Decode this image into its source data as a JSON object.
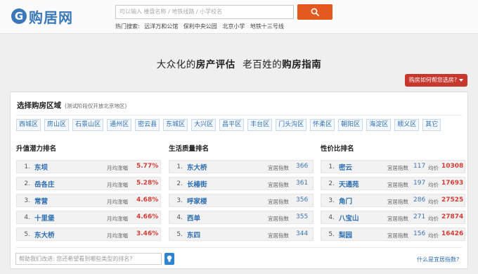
{
  "header": {
    "logo_text": "购居网",
    "logo_letter": "G",
    "search_placeholder": "可以输入 楼盘名称 / 地铁线路 / 小学校名",
    "hot_label": "热门搜索:",
    "hot_links": [
      "远洋万和公馆",
      "保利中央公园",
      "北京小学",
      "地铁十三号线"
    ]
  },
  "slogan": {
    "part1": "大众化的",
    "part2": "房产评估",
    "part3": "老百姓的",
    "part4": "购房指南"
  },
  "help_button": "购房如何帮您选房?",
  "panel": {
    "title": "选择购房区域",
    "note": "(测试阶段仅开放北京地区)",
    "districts": [
      "西城区",
      "房山区",
      "石景山区",
      "通州区",
      "密云县",
      "东城区",
      "大兴区",
      "昌平区",
      "丰台区",
      "门头沟区",
      "怀柔区",
      "朝阳区",
      "海淀区",
      "顺义区",
      "其它"
    ],
    "columns": [
      {
        "title": "升值潜力排名",
        "metric_label": "月均涨幅",
        "rows": [
          {
            "rank": "1.",
            "name": "东坝",
            "value": "5.77%"
          },
          {
            "rank": "2.",
            "name": "岳各庄",
            "value": "5.28%"
          },
          {
            "rank": "3.",
            "name": "常营",
            "value": "4.68%"
          },
          {
            "rank": "4.",
            "name": "十里堡",
            "value": "4.66%"
          },
          {
            "rank": "5.",
            "name": "东大桥",
            "value": "3.46%"
          }
        ]
      },
      {
        "title": "生活质量排名",
        "metric_label": "宜居指数",
        "rows": [
          {
            "rank": "1.",
            "name": "东大桥",
            "value": "366"
          },
          {
            "rank": "2.",
            "name": "长椿街",
            "value": "361"
          },
          {
            "rank": "3.",
            "name": "呼家楼",
            "value": "356"
          },
          {
            "rank": "4.",
            "name": "西单",
            "value": "355"
          },
          {
            "rank": "5.",
            "name": "东四",
            "value": "344"
          }
        ]
      },
      {
        "title": "性价比排名",
        "metric_label": "宜居指数",
        "price_label": "均价",
        "rows": [
          {
            "rank": "1.",
            "name": "密云",
            "value": "117",
            "price": "10308"
          },
          {
            "rank": "2.",
            "name": "天通苑",
            "value": "197",
            "price": "17693"
          },
          {
            "rank": "3.",
            "name": "角门",
            "value": "286",
            "price": "27525"
          },
          {
            "rank": "4.",
            "name": "八宝山",
            "value": "271",
            "price": "27874"
          },
          {
            "rank": "5.",
            "name": "梨园",
            "value": "156",
            "price": "16426"
          }
        ]
      }
    ],
    "feedback_placeholder": "帮助我们改进: 您还希望看到哪些类型的排名?",
    "what_link": "什么是宜居指数?"
  },
  "colors": {
    "brand_blue": "#3a78b9",
    "search_orange": "#e4591f",
    "help_red": "#c8372d",
    "value_red": "#d23d34"
  }
}
